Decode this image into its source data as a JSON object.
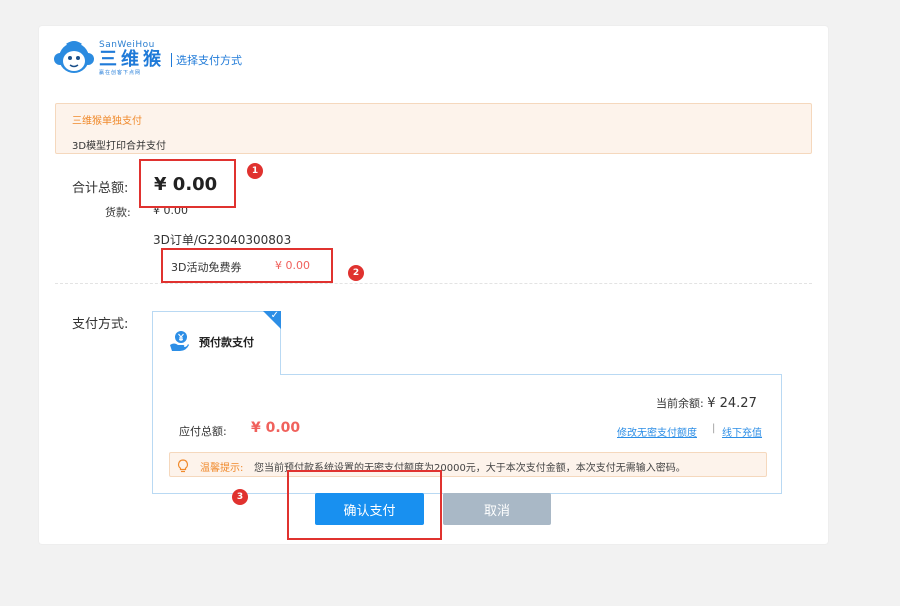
{
  "header": {
    "logo_en": "SanWeiHou",
    "logo_cn": "三维猴",
    "logo_sub": "赢在创客下点网",
    "title": "选择支付方式"
  },
  "payment_options": {
    "separate": "三维猴单独支付",
    "combined": "3D模型打印合并支付"
  },
  "summary": {
    "total_label": "合计总额:",
    "total_value": "¥ 0.00",
    "goods_label": "货款:",
    "goods_value": "¥ 0.00",
    "order_id": "3D订单/G23040300803",
    "coupon_label": "3D活动免费券",
    "coupon_value": "¥ 0.00"
  },
  "pay_method": {
    "label": "支付方式:",
    "tab_label": "预付款支付",
    "balance_label": "当前余额:",
    "balance_value": "¥ 24.27",
    "due_label": "应付总额:",
    "due_value": "¥ 0.00",
    "link_modify": "修改无密支付额度",
    "link_sep": "|",
    "link_recharge": "线下充值",
    "tip_title": "温馨提示:",
    "tip_text": "您当前预付款系统设置的无密支付额度为20000元，大于本次支付金额，本次支付无需输入密码。"
  },
  "buttons": {
    "confirm": "确认支付",
    "cancel": "取消"
  },
  "annotations": [
    "1",
    "2",
    "3"
  ],
  "colors": {
    "brand_blue": "#1f7ad8",
    "primary_button": "#1890f0",
    "price_red": "#f0615c",
    "annotation_red": "#e0322f",
    "warning_orange": "#f08a2c"
  }
}
